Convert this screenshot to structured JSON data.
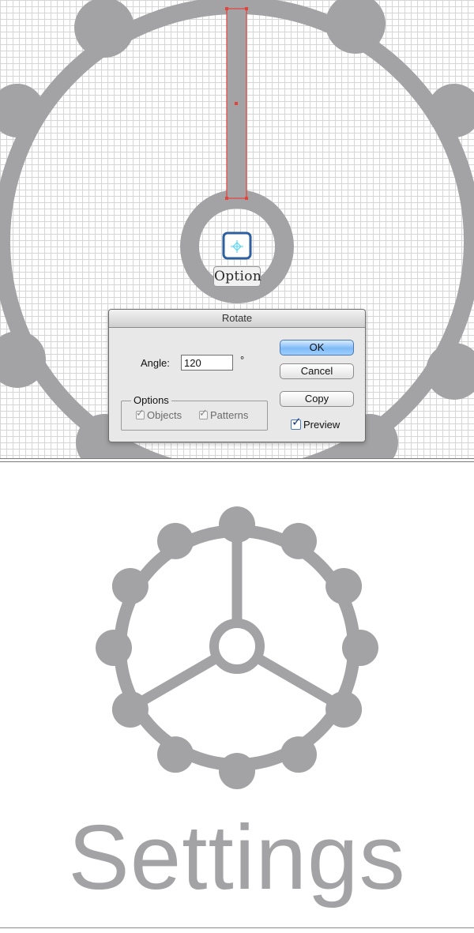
{
  "colors": {
    "icon_gray": "#a3a3a5",
    "selection_red": "#e6423b",
    "anchor_blue": "#2e5f9e",
    "anchor_cyan": "#5fd8f5",
    "grid_line": "#d6d6d6"
  },
  "canvas": {
    "tooltip_label": "Option"
  },
  "rotate_dialog": {
    "title": "Rotate",
    "angle_label": "Angle:",
    "angle_value": "120",
    "angle_unit": "°",
    "options_legend": "Options",
    "option_objects": "Objects",
    "option_patterns": "Patterns",
    "ok_label": "OK",
    "cancel_label": "Cancel",
    "copy_label": "Copy",
    "preview_label": "Preview",
    "check_glyph": "✓"
  },
  "result": {
    "title": "Settings"
  }
}
